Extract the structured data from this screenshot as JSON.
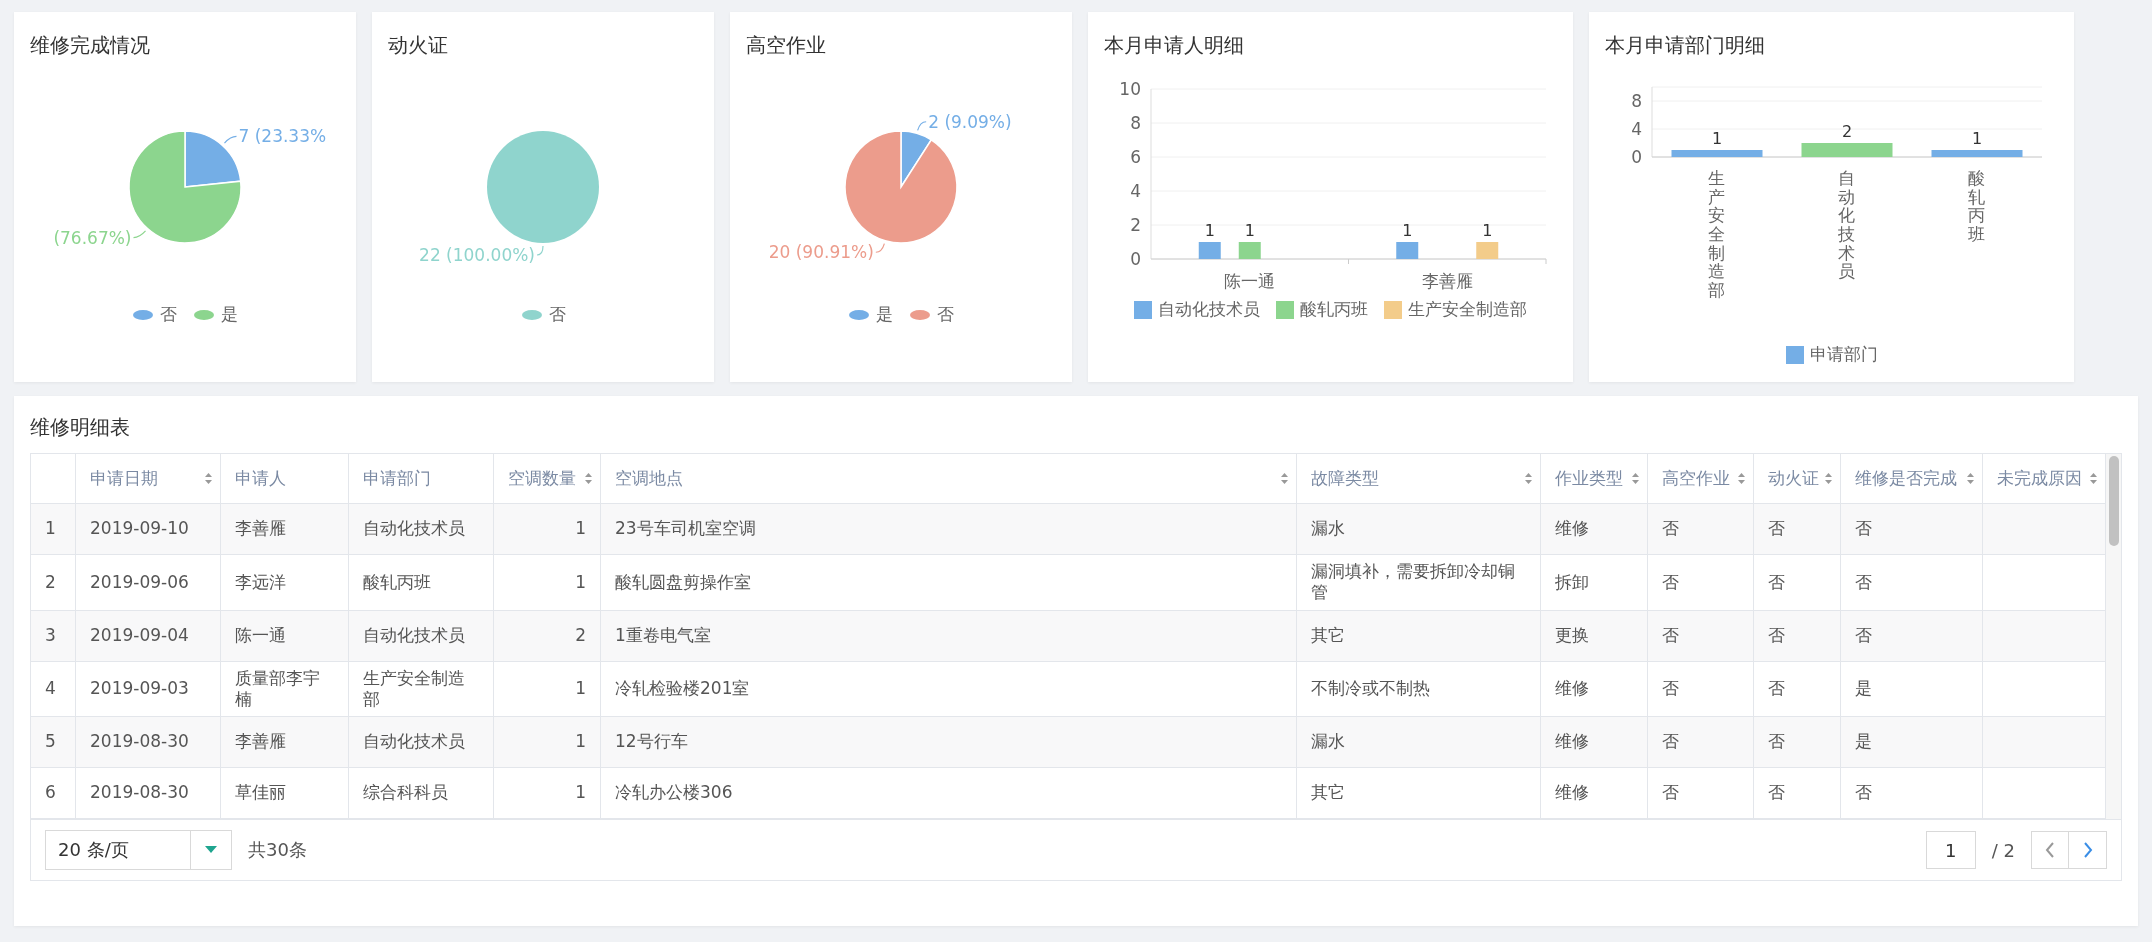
{
  "cards": [
    {
      "title": "维修完成情况",
      "chart_data": {
        "type": "pie",
        "categories": [
          "否",
          "是"
        ],
        "values": [
          23.33,
          76.67
        ],
        "legend": "bottom",
        "colors": [
          "#74aee6",
          "#8cd58e"
        ],
        "value_labels": [
          "7 (23.33%",
          "(76.67%)"
        ]
      }
    },
    {
      "title": "动火证",
      "chart_data": {
        "type": "pie",
        "categories": [
          "否"
        ],
        "values": [
          22
        ],
        "legend": "bottom",
        "colors": [
          "#8fd4cd"
        ],
        "value_labels": [
          "22 (100.00%)"
        ]
      }
    },
    {
      "title": "高空作业",
      "chart_data": {
        "type": "pie",
        "categories": [
          "是",
          "否"
        ],
        "values": [
          2,
          20
        ],
        "legend": "bottom",
        "colors": [
          "#74aee6",
          "#ec9c8c"
        ],
        "value_labels": [
          "2 (9.09%)",
          "20 (90.91%)"
        ]
      }
    },
    {
      "title": "本月申请人明细",
      "kind": "grouped",
      "chart_data": {
        "type": "bar",
        "categories": [
          "陈一通",
          "李善雁"
        ],
        "ylim": [
          0,
          10
        ],
        "yticks": [
          0,
          2,
          4,
          6,
          8,
          10
        ],
        "data_labels": true,
        "grid": true,
        "legend": "bottom",
        "series": [
          {
            "name": "自动化技术员",
            "color": "#74aee6",
            "values": [
              1,
              1
            ]
          },
          {
            "name": "酸轧丙班",
            "color": "#8cd58e",
            "values": [
              1,
              null
            ]
          },
          {
            "name": "生产安全制造部",
            "color": "#f3cc8a",
            "values": [
              null,
              1
            ]
          }
        ]
      }
    },
    {
      "title": "本月申请部门明细",
      "kind": "vertical",
      "chart_data": {
        "type": "bar",
        "categories": [
          "生产安全制造部",
          "自动化技术员",
          "酸轧丙班"
        ],
        "ylim": [
          0,
          10
        ],
        "yticks": [
          0,
          4,
          8
        ],
        "data_labels": true,
        "grid": true,
        "legend": "bottom",
        "series": [
          {
            "name": "申请部门",
            "color": "#74aee6",
            "values": [
              1,
              null,
              1
            ]
          },
          {
            "color": "#8cd58e",
            "values": [
              null,
              2,
              null
            ]
          }
        ]
      }
    }
  ],
  "table": {
    "title": "维修明细表",
    "columns": [
      {
        "label": "申请日期",
        "sortable": true
      },
      {
        "label": "申请人",
        "sortable": false
      },
      {
        "label": "申请部门",
        "sortable": false
      },
      {
        "label": "空调数量",
        "sortable": true,
        "kind": "number"
      },
      {
        "label": "空调地点",
        "sortable": true
      },
      {
        "label": "故障类型",
        "sortable": true
      },
      {
        "label": "作业类型",
        "sortable": true
      },
      {
        "label": "高空作业",
        "sortable": true
      },
      {
        "label": "动火证",
        "sortable": true
      },
      {
        "label": "维修是否完成",
        "sortable": true
      },
      {
        "label": "未完成原因",
        "sortable": true
      }
    ],
    "rows": [
      {
        "number": "1",
        "cells": [
          "2019-09-10",
          "李善雁",
          "自动化技术员",
          "1",
          "23号车司机室空调",
          "漏水",
          "维修",
          "否",
          "否",
          "否"
        ]
      },
      {
        "number": "2",
        "cells": [
          "2019-09-06",
          "李远洋",
          "酸轧丙班",
          "1",
          "酸轧圆盘剪操作室",
          "漏洞填补，需要拆卸冷却铜管",
          "拆卸",
          "否",
          "否",
          "否"
        ]
      },
      {
        "number": "3",
        "cells": [
          "2019-09-04",
          "陈一通",
          "自动化技术员",
          "2",
          "1重卷电气室",
          "其它",
          "更换",
          "否",
          "否",
          "否"
        ]
      },
      {
        "number": "4",
        "cells": [
          "2019-09-03",
          "质量部李宇楠",
          "生产安全制造部",
          "1",
          "冷轧检验楼201室",
          "不制冷或不制热",
          "维修",
          "否",
          "否",
          "是"
        ]
      },
      {
        "number": "5",
        "cells": [
          "2019-08-30",
          "李善雁",
          "自动化技术员",
          "1",
          "12号行车",
          "漏水",
          "维修",
          "否",
          "否",
          "是"
        ]
      },
      {
        "number": "6",
        "cells": [
          "2019-08-30",
          "草佳丽",
          "综合科科员",
          "1",
          "冷轧办公楼306",
          "其它",
          "维修",
          "否",
          "否",
          "否"
        ]
      }
    ]
  },
  "pagination": {
    "page_size": "20 条/页",
    "total": "共30条",
    "page": "1",
    "pages": "/ 2",
    "prev_disabled": true,
    "next_disabled": false
  }
}
